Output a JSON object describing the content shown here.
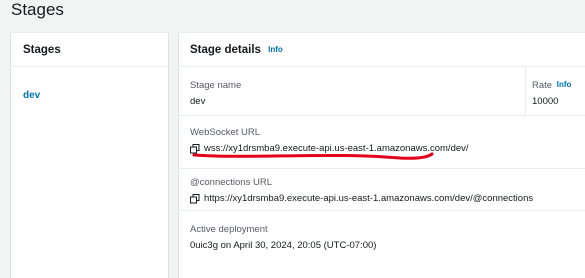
{
  "page": {
    "title": "Stages"
  },
  "left_panel": {
    "title": "Stages",
    "stages": [
      "dev"
    ]
  },
  "details": {
    "title": "Stage details",
    "info_label": "Info",
    "stage_name_label": "Stage name",
    "stage_name": "dev",
    "rate_label": "Rate",
    "rate_info_label": "Info",
    "rate_value": "10000",
    "websocket_url_label": "WebSocket URL",
    "websocket_url": "wss://xy1drsmba9.execute-api.us-east-1.amazonaws.com/dev/",
    "connections_url_label": "@connections URL",
    "connections_url": "https://xy1drsmba9.execute-api.us-east-1.amazonaws.com/dev/@connections",
    "active_deployment_label": "Active deployment",
    "active_deployment": "0uic3g on April 30, 2024, 20:05 (UTC-07:00)"
  },
  "annotation": {
    "color": "#e3001b",
    "icon": "red-underline-annotation"
  },
  "colors": {
    "link": "#0073bb",
    "background": "#f2f3f3"
  }
}
